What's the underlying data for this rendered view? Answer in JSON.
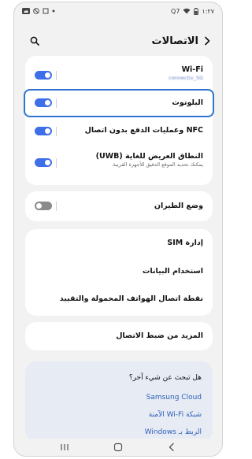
{
  "status_bar": {
    "time": "١:٢٧",
    "icons_right": [
      "sim-icon",
      "wifi-icon",
      "battery-icon"
    ],
    "icons_left": [
      "notification-icon",
      "no-disturb-icon",
      "screenshot-icon",
      "dot-icon"
    ],
    "sim_label": "Q7"
  },
  "header": {
    "title": "الاتصالات"
  },
  "card1": {
    "items": [
      {
        "title": "Wi-Fi",
        "subtitle": "connectiv_5G",
        "toggle": "on"
      },
      {
        "title": "البلوتوث",
        "toggle": "on"
      },
      {
        "title": "NFC وعمليات الدفع بدون اتصال",
        "toggle": "on"
      },
      {
        "title": "النطاق العريض للغاية (UWB)",
        "subtitle": "يمكنك تحديد الموقع الدقيق للأجهزة القريبة.",
        "toggle": "on"
      }
    ]
  },
  "card2": {
    "title": "وضع الطيران",
    "toggle": "off"
  },
  "card3": {
    "items": [
      {
        "title": "إدارة SIM"
      },
      {
        "title": "استخدام البيانات"
      },
      {
        "title": "نقطة اتصال الهواتف المحمولة والتقييد"
      }
    ]
  },
  "card4": {
    "title": "المزيد من ضبط الاتصال"
  },
  "suggestions": {
    "title": "هل تبحث عن شيء آخر؟",
    "links": [
      "Samsung Cloud",
      "شبكة Wi-Fi الآمنة",
      "الربط بـ Windows"
    ]
  },
  "colors": {
    "accent": "#3e6ee8",
    "highlight": "#2f74d0",
    "link": "#2f5fb8"
  }
}
